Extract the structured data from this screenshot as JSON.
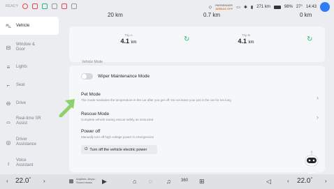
{
  "status": {
    "ready": "READY",
    "airbag_label": "PASSENGER",
    "airbag_value": "AIRBAG OFF",
    "range": "271 km",
    "battery": "98%",
    "temp": "27°",
    "time": "14:43"
  },
  "sidebar": {
    "items": [
      {
        "label": "Vehicle",
        "icon": "car-icon"
      },
      {
        "label": "Window &",
        "label2": "Door",
        "icon": "window-door-icon"
      },
      {
        "label": "Lights",
        "icon": "lights-icon"
      },
      {
        "label": "Seat",
        "icon": "seat-icon"
      },
      {
        "label": "Drive",
        "icon": "steering-icon"
      },
      {
        "label": "Real-time SR",
        "label2": "Assist",
        "icon": "sr-icon"
      },
      {
        "label": "Driver",
        "label2": "Assistance",
        "icon": "driver-assist-icon"
      },
      {
        "label": "Voice",
        "label2": "Assistant",
        "icon": "voice-icon"
      }
    ]
  },
  "odometer": {
    "frag_a": "20 km",
    "frag_b": "0.7 km",
    "frag_c": "0 km"
  },
  "trips": {
    "trip_a_label": "Trip A",
    "trip_a_value": "4.1",
    "trip_b_label": "Trip B",
    "trip_b_value": "4.1",
    "unit": "km"
  },
  "vehicle_mode": {
    "title": "Vehicle Mode",
    "wiper_label": "Wiper Maintenance Mode",
    "pet_title": "Pet Mode",
    "pet_sub": "The mode maintains the temperature in the car after you get off. Do not leave your pet in the car for too long",
    "rescue_title": "Rescue Mode",
    "rescue_sub": "Complete vehicle towing rescue safely as instructed",
    "power_title": "Power off",
    "power_sub": "Manually turn off high voltage power in emergencies",
    "power_button": "Turn off the vehicle electric power"
  },
  "dock": {
    "left_temp": "22.0",
    "right_temp": "22.0",
    "temp_unit": "°",
    "song_title": "Anytime, Anyw...",
    "song_artist": "Sound music",
    "num_360": "360"
  }
}
